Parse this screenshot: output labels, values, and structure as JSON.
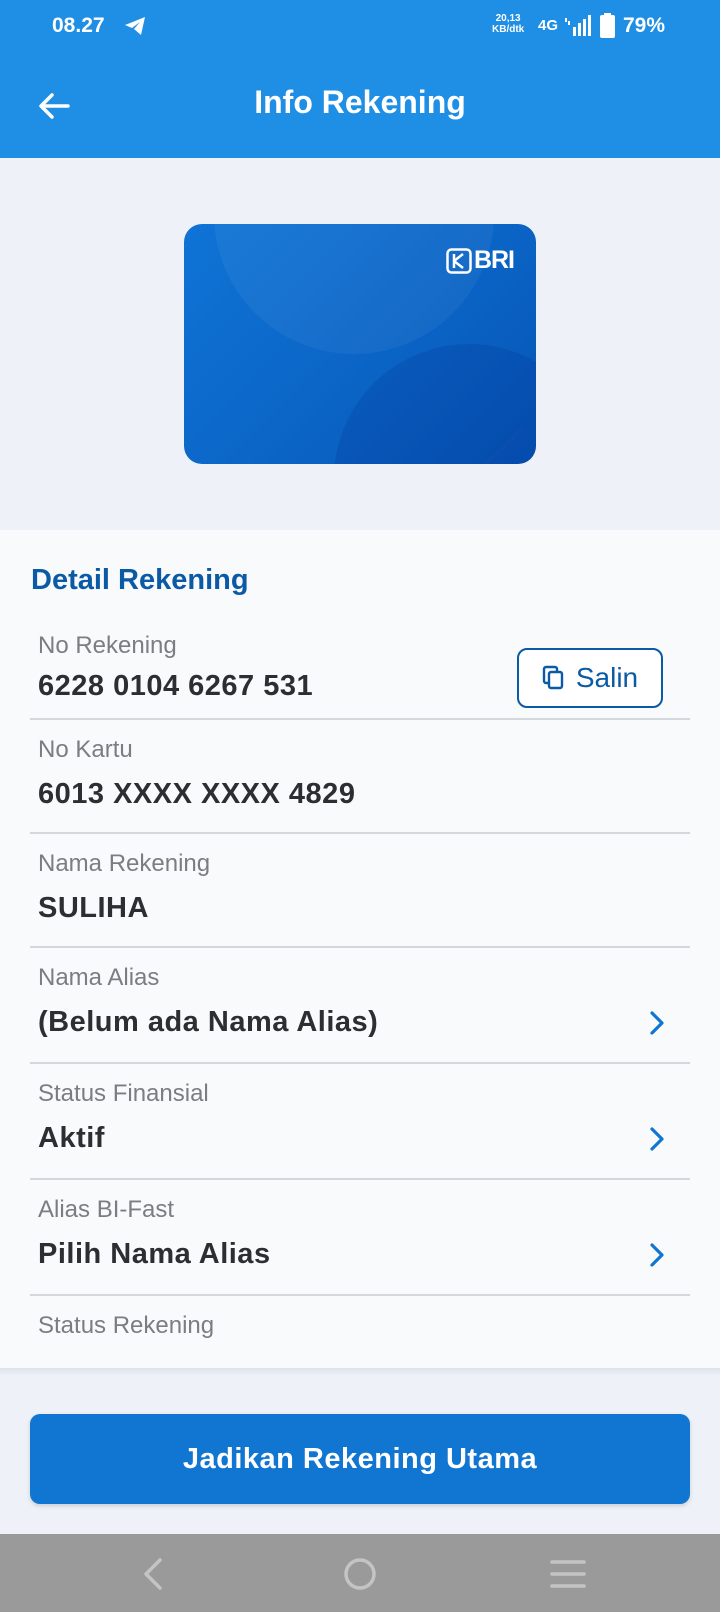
{
  "status_bar": {
    "time": "08.27",
    "net_speed_value": "20,13",
    "net_speed_unit": "KB/dtk",
    "network": "4G",
    "battery": "79%"
  },
  "header": {
    "title": "Info Rekening"
  },
  "card": {
    "brand": "BRI"
  },
  "detail": {
    "section_title": "Detail Rekening",
    "copy_label": "Salin",
    "rows": [
      {
        "label": "No Rekening",
        "value": "6228 0104 6267 531"
      },
      {
        "label": "No Kartu",
        "value": "6013 XXXX XXXX 4829"
      },
      {
        "label": "Nama Rekening",
        "value": "SULIHA"
      },
      {
        "label": "Nama Alias",
        "value": "(Belum ada Nama Alias)"
      },
      {
        "label": "Status Finansial",
        "value": "Aktif"
      },
      {
        "label": "Alias BI-Fast",
        "value": "Pilih Nama Alias"
      },
      {
        "label": "Status Rekening",
        "value": ""
      }
    ]
  },
  "actions": {
    "primary_label": "Jadikan Rekening Utama"
  },
  "colors": {
    "header": "#1f8fe5",
    "accent": "#0b5aa5",
    "button": "#1175d2"
  }
}
